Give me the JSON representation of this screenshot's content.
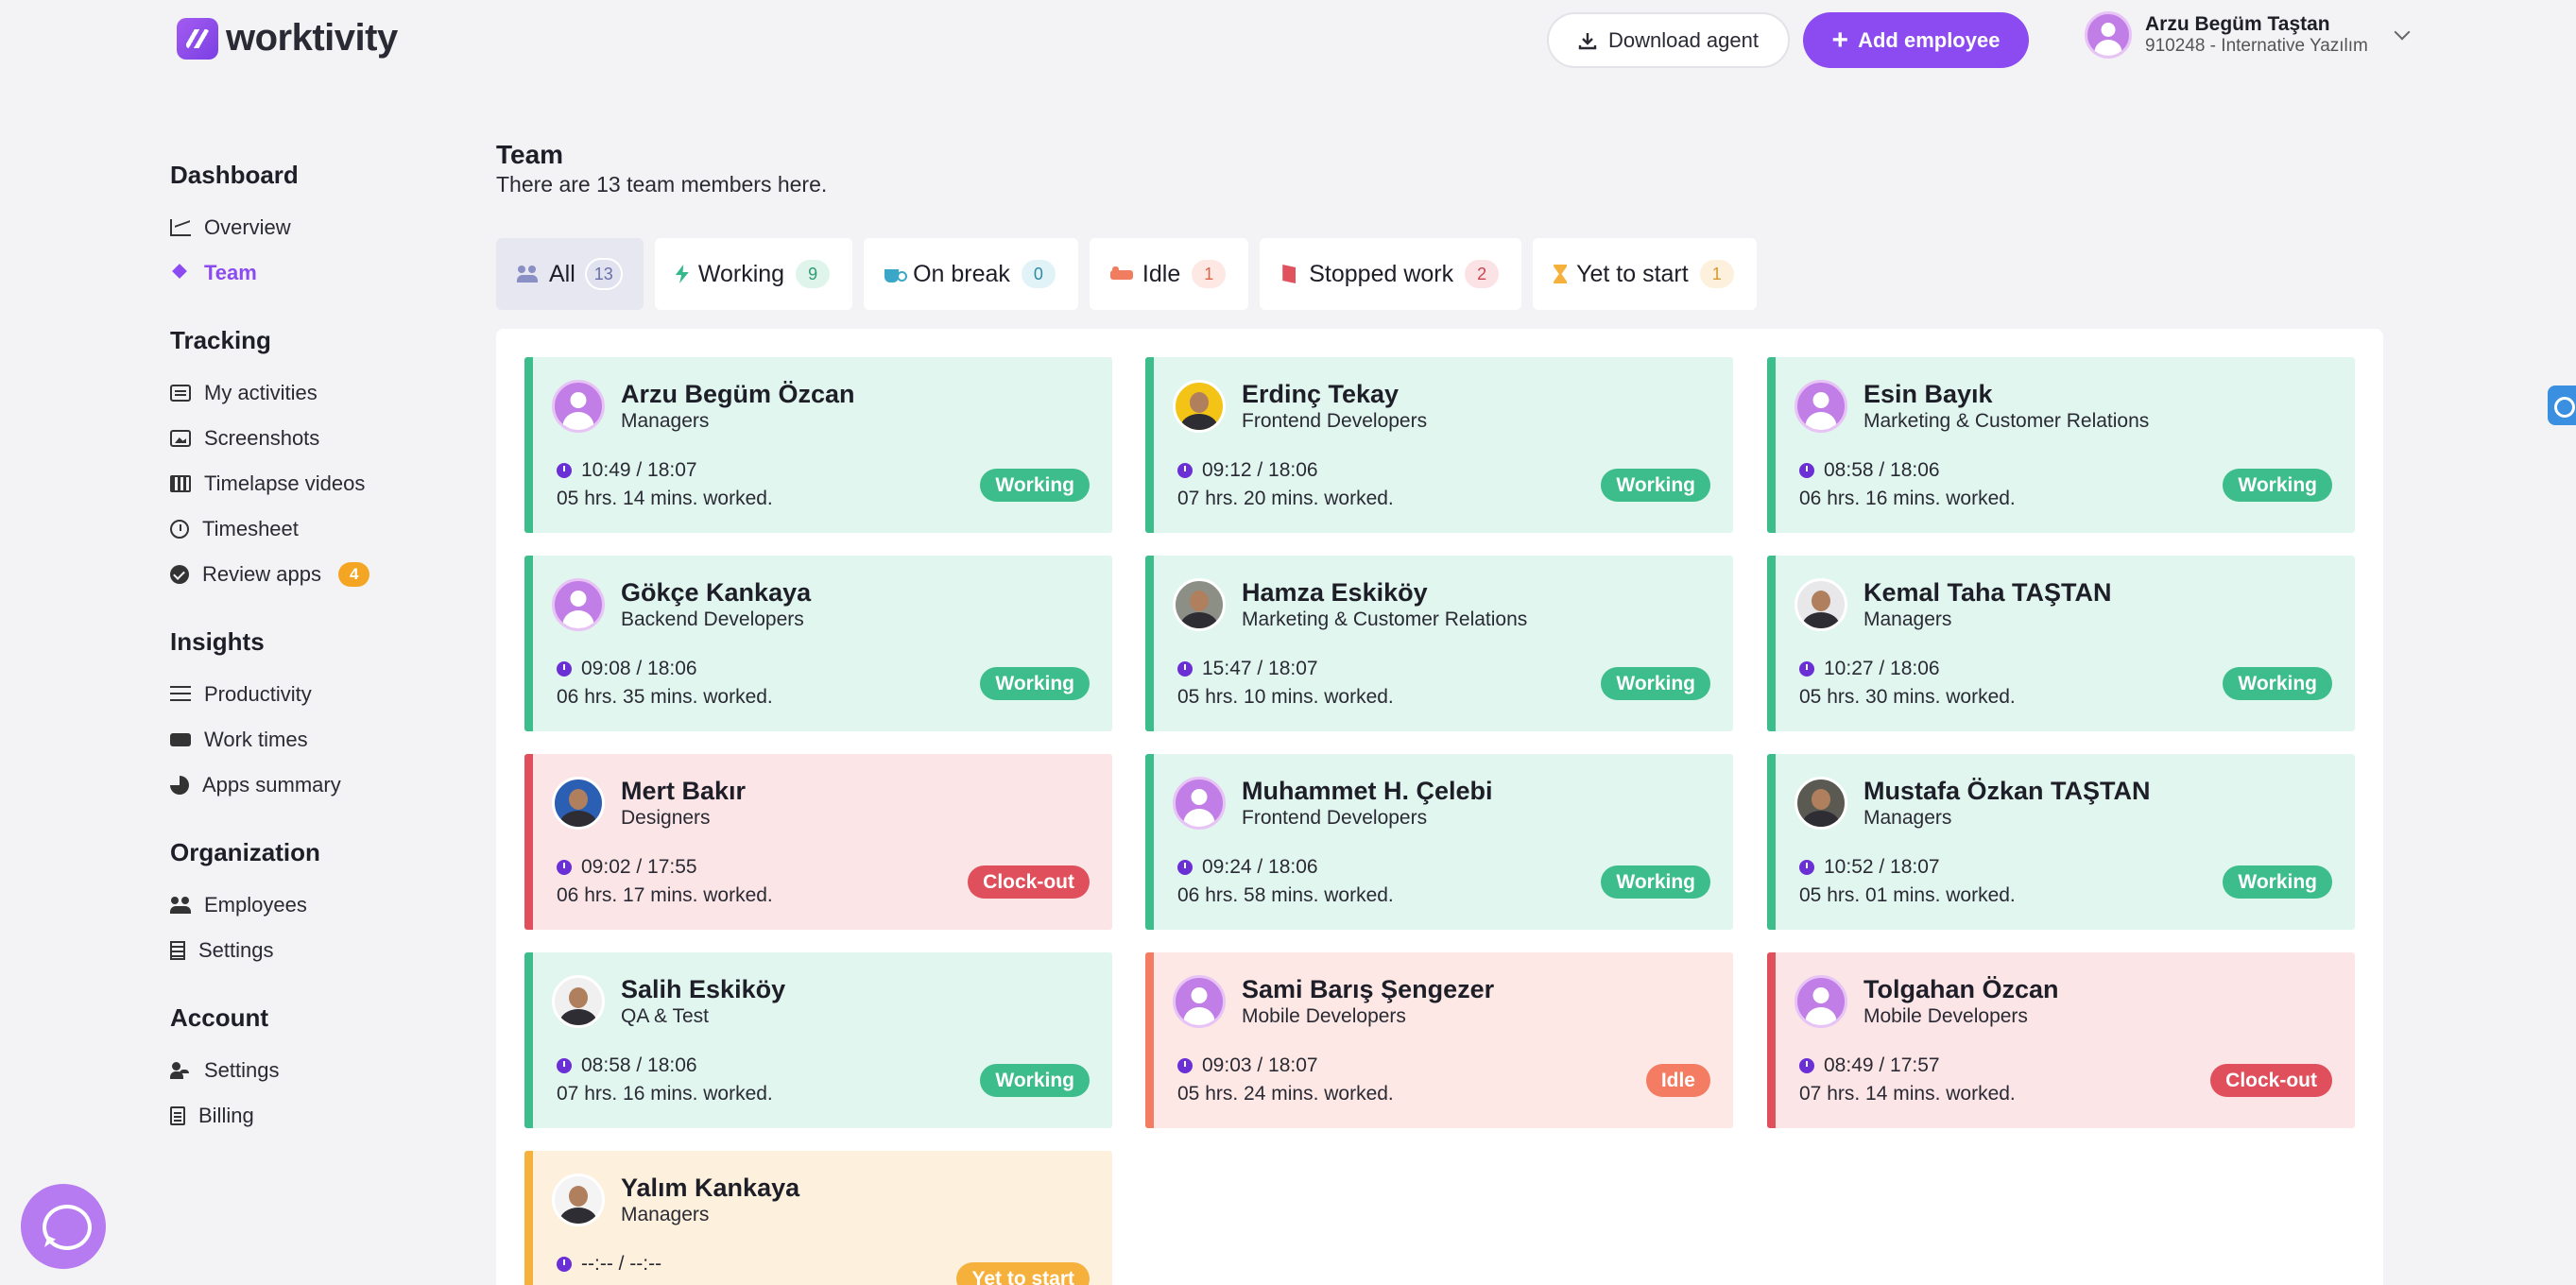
{
  "brand": {
    "name": "worktivity"
  },
  "header": {
    "download_label": "Download agent",
    "add_label": "Add employee",
    "user": {
      "name": "Arzu Begüm Taştan",
      "org": "910248 - Internative Yazılım"
    }
  },
  "sidebar": {
    "dashboard": {
      "title": "Dashboard",
      "items": [
        "Overview",
        "Team"
      ]
    },
    "tracking": {
      "title": "Tracking",
      "items": [
        "My activities",
        "Screenshots",
        "Timelapse videos",
        "Timesheet",
        "Review apps"
      ],
      "review_badge": "4"
    },
    "insights": {
      "title": "Insights",
      "items": [
        "Productivity",
        "Work times",
        "Apps summary"
      ]
    },
    "organization": {
      "title": "Organization",
      "items": [
        "Employees",
        "Settings"
      ]
    },
    "account": {
      "title": "Account",
      "items": [
        "Settings",
        "Billing"
      ]
    }
  },
  "main": {
    "title": "Team",
    "subtitle": "There are 13 team members here."
  },
  "tabs": [
    {
      "label": "All",
      "count": "13",
      "icon": "users-icon"
    },
    {
      "label": "Working",
      "count": "9",
      "icon": "bolt-icon"
    },
    {
      "label": "On break",
      "count": "0",
      "icon": "coffee-icon"
    },
    {
      "label": "Idle",
      "count": "1",
      "icon": "bed-icon"
    },
    {
      "label": "Stopped work",
      "count": "2",
      "icon": "door-icon"
    },
    {
      "label": "Yet to start",
      "count": "1",
      "icon": "hourglass-icon"
    }
  ],
  "colors": {
    "accent": "#8c4bf0",
    "working": "#3dbd8b",
    "clockout": "#e04f5c",
    "idle": "#f37c62",
    "yet": "#f5b13c"
  },
  "members": [
    {
      "name": "Arzu Begüm Özcan",
      "role": "Managers",
      "time": "10:49 / 18:07",
      "worked": "05 hrs. 14 mins. worked.",
      "status": "Working"
    },
    {
      "name": "Erdinç Tekay",
      "role": "Frontend Developers",
      "time": "09:12 / 18:06",
      "worked": "07 hrs. 20 mins. worked.",
      "status": "Working"
    },
    {
      "name": "Esin Bayık",
      "role": "Marketing & Customer Relations",
      "time": "08:58 / 18:06",
      "worked": "06 hrs. 16 mins. worked.",
      "status": "Working"
    },
    {
      "name": "Gökçe Kankaya",
      "role": "Backend Developers",
      "time": "09:08 / 18:06",
      "worked": "06 hrs. 35 mins. worked.",
      "status": "Working"
    },
    {
      "name": "Hamza Eskiköy",
      "role": "Marketing & Customer Relations",
      "time": "15:47 / 18:07",
      "worked": "05 hrs. 10 mins. worked.",
      "status": "Working"
    },
    {
      "name": "Kemal Taha TAŞTAN",
      "role": "Managers",
      "time": "10:27 / 18:06",
      "worked": "05 hrs. 30 mins. worked.",
      "status": "Working"
    },
    {
      "name": "Mert Bakır",
      "role": "Designers",
      "time": "09:02 / 17:55",
      "worked": "06 hrs. 17 mins. worked.",
      "status": "Clock-out"
    },
    {
      "name": "Muhammet H. Çelebi",
      "role": "Frontend Developers",
      "time": "09:24 / 18:06",
      "worked": "06 hrs. 58 mins. worked.",
      "status": "Working"
    },
    {
      "name": "Mustafa Özkan TAŞTAN",
      "role": "Managers",
      "time": "10:52 / 18:07",
      "worked": "05 hrs. 01 mins. worked.",
      "status": "Working"
    },
    {
      "name": "Salih Eskiköy",
      "role": "QA & Test",
      "time": "08:58 / 18:06",
      "worked": "07 hrs. 16 mins. worked.",
      "status": "Working"
    },
    {
      "name": "Sami Barış Şengezer",
      "role": "Mobile Developers",
      "time": "09:03 / 18:07",
      "worked": "05 hrs. 24 mins. worked.",
      "status": "Idle"
    },
    {
      "name": "Tolgahan Özcan",
      "role": "Mobile Developers",
      "time": "08:49 / 17:57",
      "worked": "07 hrs. 14 mins. worked.",
      "status": "Clock-out"
    },
    {
      "name": "Yalım Kankaya",
      "role": "Managers",
      "time": "--:-- / --:--",
      "worked": "",
      "status": "Yet to start"
    }
  ]
}
